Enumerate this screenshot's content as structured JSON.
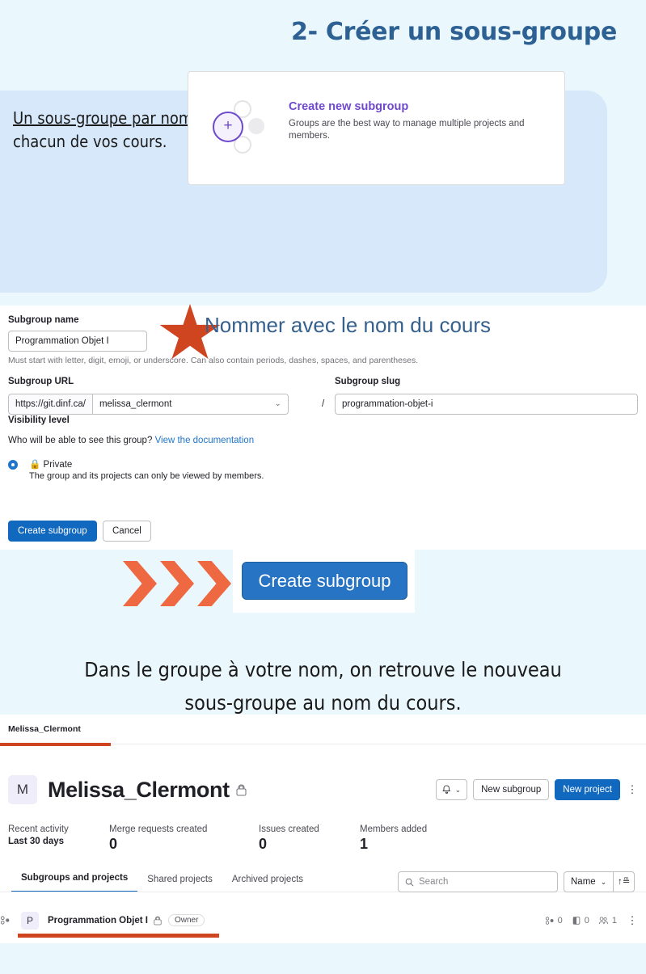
{
  "slide": {
    "title": "2- Créer un sous-groupe",
    "intro_underlined": "Un sous-groupe par nom de cours",
    "intro_rest": " pour y déposer les projets de chacun de vos cours.",
    "annotation": "Nommer avec le nom du cours",
    "caption_line1": "Dans le groupe à votre nom, on retrouve le nouveau",
    "caption_line2": "sous-groupe au  nom du cours.",
    "cta_button_label": "Create subgroup"
  },
  "colors": {
    "page_background": "#eaf7fc",
    "blue_card": "#d6e8fa",
    "title_blue": "#2e6193",
    "accent_orange": "#cf4520",
    "arrow_orange": "#ee6841",
    "gitlab_purple": "#6e49cb",
    "gitlab_blue": "#1068bf"
  },
  "subgroup_tile": {
    "title": "Create new subgroup",
    "description": "Groups are the best way to manage multiple projects and members.",
    "icon": "plus-circle-icon"
  },
  "form": {
    "name_label": "Subgroup name",
    "name_value": "Programmation Objet I",
    "name_helper": "Must start with letter, digit, emoji, or underscore. Can also contain periods, dashes, spaces, and parentheses.",
    "url_label": "Subgroup URL",
    "url_prefix": "https://git.dinf.ca/",
    "url_parent": "melissa_clermont",
    "url_separator": "/",
    "slug_label": "Subgroup slug",
    "slug_value": "programmation-objet-i",
    "visibility_label": "Visibility level",
    "visibility_question": "Who will be able to see this group?",
    "visibility_doc_link": "View the documentation",
    "visibility_option": "Private",
    "visibility_option_desc": "The group and its projects can only be viewed by members.",
    "submit_label": "Create subgroup",
    "cancel_label": "Cancel"
  },
  "gitlab": {
    "breadcrumb": "Melissa_Clermont",
    "avatar_initial": "M",
    "group_name": "Melissa_Clermont",
    "group_visibility_icon": "lock-icon",
    "bell_icon": "bell-icon",
    "new_subgroup_label": "New subgroup",
    "new_project_label": "New project",
    "kebab_icon": "kebab-menu-icon",
    "stats": [
      {
        "label": "Recent activity",
        "value": "",
        "sub": "Last 30 days"
      },
      {
        "label": "Merge requests created",
        "value": "0",
        "sub": ""
      },
      {
        "label": "Issues created",
        "value": "0",
        "sub": ""
      },
      {
        "label": "Members added",
        "value": "1",
        "sub": ""
      }
    ],
    "tabs": [
      {
        "label": "Subgroups and projects",
        "active": true
      },
      {
        "label": "Shared projects",
        "active": false
      },
      {
        "label": "Archived projects",
        "active": false
      }
    ],
    "search_placeholder": "Search",
    "search_value": "",
    "sort_label": "Name",
    "sort_direction_icon": "sort-ascending-icon",
    "row": {
      "avatar_initial": "P",
      "name": "Programmation Objet I",
      "visibility_icon": "lock-icon",
      "badge": "Owner",
      "subgroups_count": "0",
      "projects_count": "0",
      "members_count": "1"
    }
  }
}
